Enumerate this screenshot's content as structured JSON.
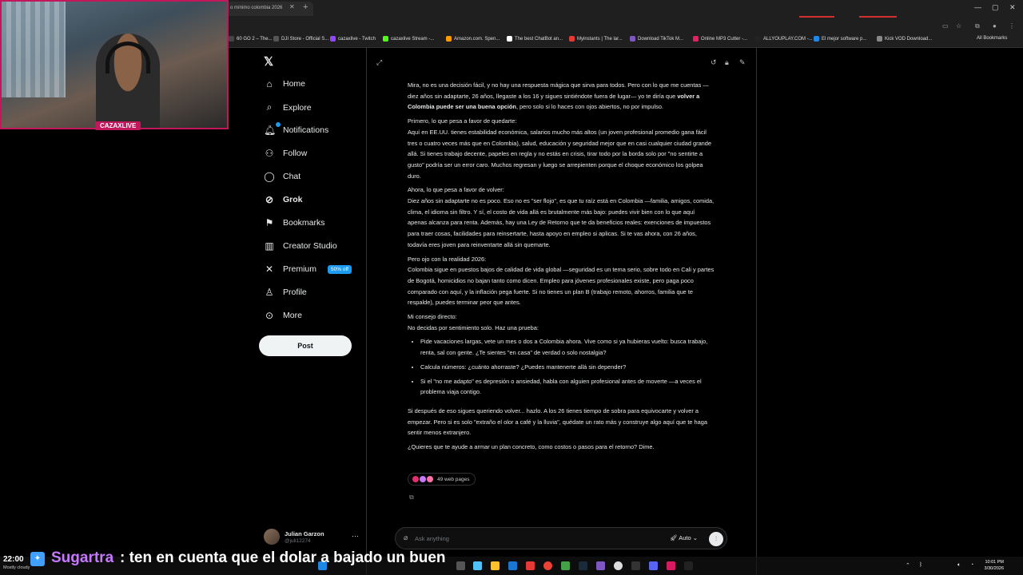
{
  "browser": {
    "active_tab_title": "o mínimo colombia 2026",
    "bookmarks": [
      {
        "label": "60 GO 2 – The...",
        "color": "#444"
      },
      {
        "label": "DJI Store - Official S...",
        "color": "#555"
      },
      {
        "label": "cazaxlive - Twitch",
        "color": "#9146ff"
      },
      {
        "label": "cazaxlive Stream -...",
        "color": "#53fc18"
      },
      {
        "label": "Amazon.com. Spen...",
        "color": "#ff9900"
      },
      {
        "label": "The best ChatBot an...",
        "color": "#ffffff"
      },
      {
        "label": "Myinstants | The lar...",
        "color": "#e53935"
      },
      {
        "label": "Download TikTok M...",
        "color": "#7e57c2"
      },
      {
        "label": "Online MP3 Cutter -...",
        "color": "#e91e63"
      },
      {
        "label": "ALLYOUPLAY.COM -...",
        "color": "#222"
      },
      {
        "label": "El mejor software p...",
        "color": "#1e88e5"
      },
      {
        "label": "Kick VOD Download...",
        "color": "#888"
      }
    ],
    "all_bookmarks": "All Bookmarks"
  },
  "nav": {
    "items": [
      {
        "label": "Home",
        "icon": "home-icon"
      },
      {
        "label": "Explore",
        "icon": "search-icon"
      },
      {
        "label": "Notifications",
        "icon": "bell-icon"
      },
      {
        "label": "Follow",
        "icon": "person-plus-icon"
      },
      {
        "label": "Chat",
        "icon": "chat-bubble-icon"
      },
      {
        "label": "Grok",
        "icon": "grok-icon"
      },
      {
        "label": "Bookmarks",
        "icon": "bookmark-icon"
      },
      {
        "label": "Creator Studio",
        "icon": "creator-studio-icon"
      },
      {
        "label": "Premium",
        "icon": "x-premium-icon"
      },
      {
        "label": "Profile",
        "icon": "person-icon"
      },
      {
        "label": "More",
        "icon": "more-circle-icon"
      }
    ],
    "premium_badge": "50% off",
    "post_label": "Post"
  },
  "user": {
    "name": "Julian Garzon",
    "handle": "@juli12274"
  },
  "response": {
    "p1_a": "Mira, no es una decisión fácil, y no hay una respuesta mágica que sirva para todos. Pero con lo que me cuentas —diez años sin adaptarte, 26 años, llegaste a los 16 y sigues sintiéndote fuera de lugar— yo te diría que ",
    "p1_b": "volver a Colombia puede ser una buena opción",
    "p1_c": ", pero solo si lo haces con ojos abiertos, no por impulso.",
    "h2": "Primero, lo que pesa a favor de quedarte:",
    "p2": "Aquí en EE.UU. tienes estabilidad económica, salarios mucho más altos (un joven profesional promedio gana fácil tres o cuatro veces más que en Colombia), salud, educación y seguridad mejor que en casi cualquier ciudad grande allá. Si tienes trabajo decente, papeles en regla y no estás en crisis, tirar todo por la borda solo por \"no sentirte a gusto\" podría ser un error caro. Muchos regresan y luego se arrepienten porque el choque económico los golpea duro.",
    "h3": "Ahora, lo que pesa a favor de volver:",
    "p3": "Diez años sin adaptarte no es poco. Eso no es \"ser flojo\", es que tu raíz está en Colombia —familia, amigos, comida, clima, el idioma sin filtro. Y sí, el costo de vida allá es brutalmente más bajo: puedes vivir bien con lo que aquí apenas alcanza para renta. Además, hay una Ley de Retorno que te da beneficios reales: exenciones de impuestos para traer cosas, facilidades para reinsertarte, hasta apoyo en empleo si aplicas. Si te vas ahora, con 26 años, todavía eres joven para reinventarte allá sin quemarte.",
    "h4": "Pero ojo con la realidad 2026:",
    "p4": "Colombia sigue en puestos bajos de calidad de vida global —seguridad es un tema serio, sobre todo en Cali y partes de Bogotá, homicidios no bajan tanto como dicen. Empleo para jóvenes profesionales existe, pero paga poco comparado con aquí, y la inflación pega fuerte. Si no tienes un plan B (trabajo remoto, ahorros, familia que te respalde), puedes terminar peor que antes.",
    "h5": "Mi consejo directo:",
    "p5": "No decidas por sentimiento solo. Haz una prueba:",
    "bullets": [
      "Pide vacaciones largas, vete un mes o dos a Colombia ahora. Vive como si ya hubieras vuelto: busca trabajo, renta, sal con gente. ¿Te sientes \"en casa\" de verdad o solo nostalgia?",
      "Calcula números: ¿cuánto ahorraste? ¿Puedes mantenerte allá sin depender?",
      "Si el \"no me adapto\" es depresión o ansiedad, habla con alguien profesional antes de moverte —a veces el problema viaja contigo."
    ],
    "p6": "Si después de eso sigues queriendo volver... hazlo. A los 26 tienes tiempo de sobra para equivocarte y volver a empezar. Pero si es solo \"extraño el olor a café y la lluvia\", quédate un rato más y construye algo aquí que te haga sentir menos extranjero.",
    "p7": "¿Quieres que te ayude a armar un plan concreto, como costos o pasos para el retorno? Dime.",
    "sources_label": "49 web pages"
  },
  "ask": {
    "placeholder": "Ask anything",
    "mode": "Auto"
  },
  "stream": {
    "cam_label": "CAZAXLIVE",
    "overlay_time": "22:00",
    "overlay_weather": "Mostly cloudy",
    "chat_user": "Sugartra",
    "chat_message": ": ten en cuenta que el dolar a bajado un buen"
  },
  "taskbar": {
    "time": "10:01 PM",
    "date": "3/30/2026"
  },
  "colors": {
    "accent": "#1d9bf0",
    "stream_border": "#c2185b",
    "chat_user": "#c678ff"
  }
}
